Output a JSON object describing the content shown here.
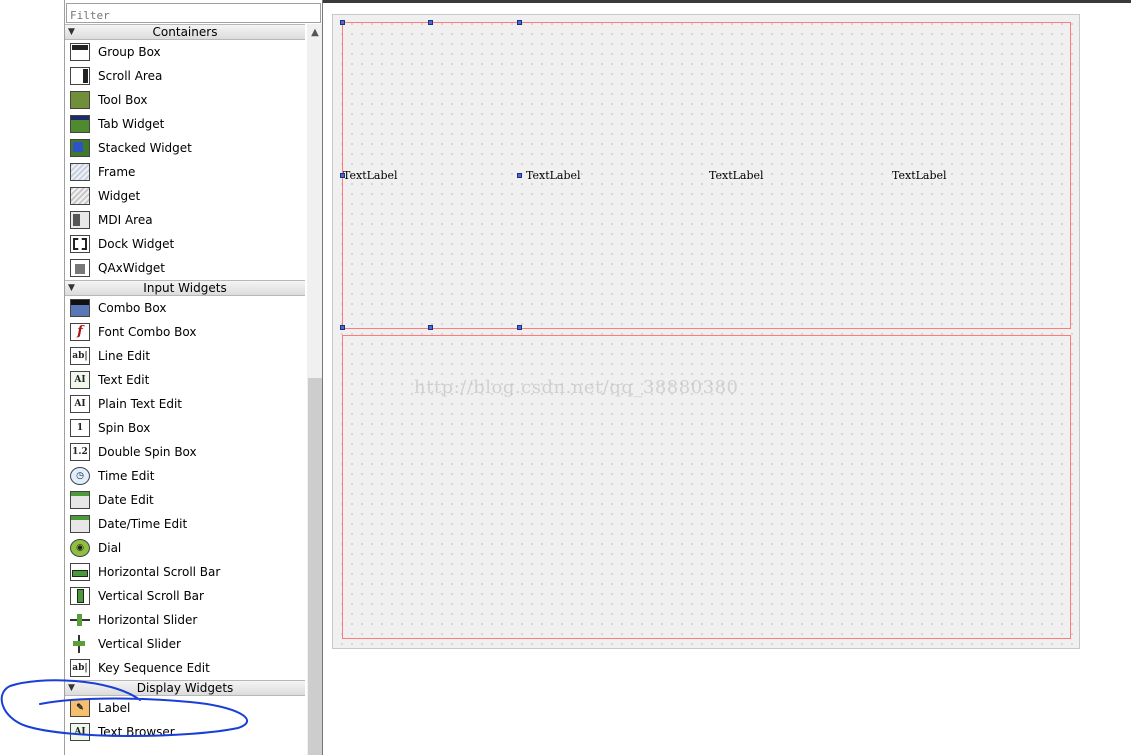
{
  "filter": {
    "placeholder": "Filter"
  },
  "categories": {
    "containers": {
      "label": "Containers",
      "items": [
        {
          "label": "Group Box",
          "icon": "group-box-icon"
        },
        {
          "label": "Scroll Area",
          "icon": "scroll-area-icon"
        },
        {
          "label": "Tool Box",
          "icon": "tool-box-icon"
        },
        {
          "label": "Tab Widget",
          "icon": "tab-widget-icon"
        },
        {
          "label": "Stacked Widget",
          "icon": "stacked-widget-icon"
        },
        {
          "label": "Frame",
          "icon": "frame-icon"
        },
        {
          "label": "Widget",
          "icon": "widget-icon"
        },
        {
          "label": "MDI Area",
          "icon": "mdi-area-icon"
        },
        {
          "label": "Dock Widget",
          "icon": "dock-widget-icon"
        },
        {
          "label": "QAxWidget",
          "icon": "qaxwidget-icon"
        }
      ]
    },
    "input": {
      "label": "Input Widgets",
      "items": [
        {
          "label": "Combo Box",
          "icon": "combo-box-icon"
        },
        {
          "label": "Font Combo Box",
          "icon": "font-combo-box-icon"
        },
        {
          "label": "Line Edit",
          "icon": "line-edit-icon"
        },
        {
          "label": "Text Edit",
          "icon": "text-edit-icon"
        },
        {
          "label": "Plain Text Edit",
          "icon": "plain-text-edit-icon"
        },
        {
          "label": "Spin Box",
          "icon": "spin-box-icon"
        },
        {
          "label": "Double Spin Box",
          "icon": "double-spin-box-icon"
        },
        {
          "label": "Time Edit",
          "icon": "time-edit-icon"
        },
        {
          "label": "Date Edit",
          "icon": "date-edit-icon"
        },
        {
          "label": "Date/Time Edit",
          "icon": "date-time-edit-icon"
        },
        {
          "label": "Dial",
          "icon": "dial-icon"
        },
        {
          "label": "Horizontal Scroll Bar",
          "icon": "horizontal-scroll-bar-icon"
        },
        {
          "label": "Vertical Scroll Bar",
          "icon": "vertical-scroll-bar-icon"
        },
        {
          "label": "Horizontal Slider",
          "icon": "horizontal-slider-icon"
        },
        {
          "label": "Vertical Slider",
          "icon": "vertical-slider-icon"
        },
        {
          "label": "Key Sequence Edit",
          "icon": "key-sequence-edit-icon"
        }
      ]
    },
    "display": {
      "label": "Display Widgets",
      "items": [
        {
          "label": "Label",
          "icon": "label-icon"
        },
        {
          "label": "Text Browser",
          "icon": "text-browser-icon"
        }
      ]
    }
  },
  "form": {
    "labels": [
      "TextLabel",
      "TextLabel",
      "TextLabel",
      "TextLabel"
    ],
    "watermark": "http://blog.csdn.net/qq_38880380"
  },
  "colors": {
    "layout_border": "#ff7b7b",
    "handle": "#4a6ad0",
    "annotation": "#1a3fd6"
  }
}
